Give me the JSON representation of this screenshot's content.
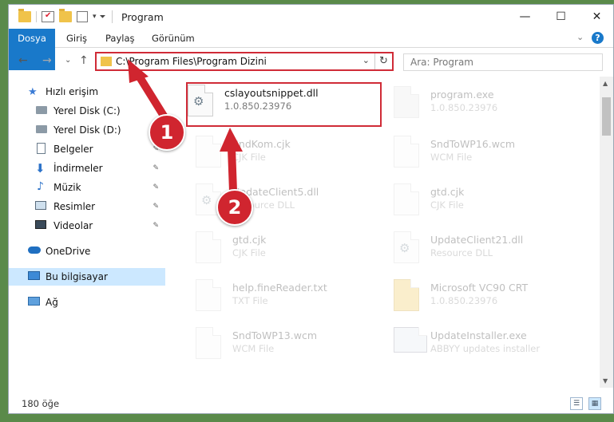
{
  "titlebar": {
    "title": "Program",
    "minimize": "—",
    "maximize": "☐",
    "close": "✕"
  },
  "ribbon": {
    "tabs": [
      "Dosya",
      "Giriş",
      "Paylaş",
      "Görünüm"
    ],
    "help": "?",
    "collapse": "⌄"
  },
  "nav": {
    "back": "←",
    "forward": "→",
    "recent": "⌄",
    "up": "↑",
    "address": "C:\\Program Files\\Program Dizini",
    "dropdown": "⌄",
    "refresh": "↻",
    "search_placeholder": "Ara: Program"
  },
  "sidebar": {
    "items": [
      {
        "label": "Hızlı erişim",
        "icon": "star-icon"
      },
      {
        "label": "Yerel Disk (C:)",
        "icon": "drive-icon"
      },
      {
        "label": "Yerel Disk (D:)",
        "icon": "drive-icon"
      },
      {
        "label": "Belgeler",
        "icon": "documents-icon"
      },
      {
        "label": "İndirmeler",
        "icon": "download-icon"
      },
      {
        "label": "Müzik",
        "icon": "music-icon"
      },
      {
        "label": "Resimler",
        "icon": "pictures-icon"
      },
      {
        "label": "Videolar",
        "icon": "videos-icon"
      },
      {
        "label": "OneDrive",
        "icon": "cloud-icon"
      },
      {
        "label": "Bu bilgisayar",
        "icon": "computer-icon"
      },
      {
        "label": "Ağ",
        "icon": "network-icon"
      }
    ],
    "pin": "📌"
  },
  "files": [
    {
      "name": "cslayoutsnippet.dll",
      "sub": "1.0.850.23976",
      "icon": "dll-gear-icon"
    },
    {
      "name": "program.exe",
      "sub": "1.0.850.23976",
      "icon": "exe-icon"
    },
    {
      "name": "SndKom.cjk",
      "sub": "CJK File",
      "icon": "file-icon"
    },
    {
      "name": "SndToWP16.wcm",
      "sub": "WCM File",
      "icon": "file-icon"
    },
    {
      "name": "UpdateClient5.dll",
      "sub": "Resource DLL",
      "icon": "dll-gear-icon"
    },
    {
      "name": "gtd.cjk",
      "sub": "CJK File",
      "icon": "file-icon"
    },
    {
      "name": "gtd.cjk",
      "sub": "CJK File",
      "icon": "file-icon"
    },
    {
      "name": "UpdateClient21.dll",
      "sub": "Resource DLL",
      "icon": "dll-gear-icon"
    },
    {
      "name": "help.fineReader.txt",
      "sub": "TXT File",
      "icon": "file-icon"
    },
    {
      "name": "Microsoft VC90 CRT",
      "sub": "1.0.850.23976",
      "icon": "folder-icon"
    },
    {
      "name": "SndToWP13.wcm",
      "sub": "WCM File",
      "icon": "file-icon"
    },
    {
      "name": "UpdateInstaller.exe",
      "sub": "ABBYY updates installer",
      "icon": "installer-icon"
    }
  ],
  "status": {
    "count": "180 öğe"
  },
  "annotations": {
    "step1": "1",
    "step2": "2",
    "color": "#d0252f"
  }
}
